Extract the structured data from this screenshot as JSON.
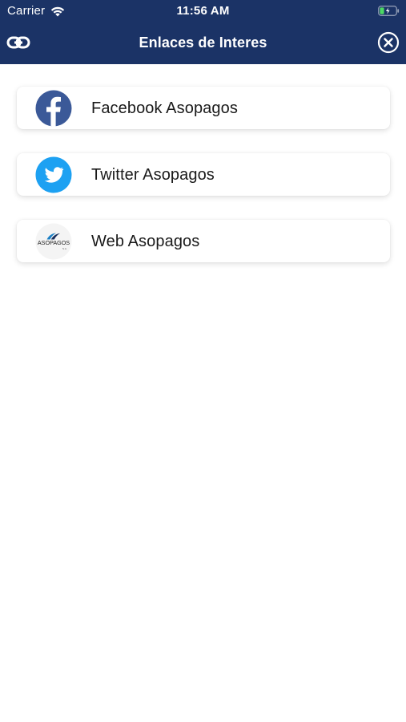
{
  "status_bar": {
    "carrier": "Carrier",
    "time": "11:56 AM"
  },
  "nav": {
    "title": "Enlaces de Interes",
    "left_icon": "link-icon",
    "right_icon": "close-circle-icon"
  },
  "links": [
    {
      "label": "Facebook Asopagos",
      "icon": "facebook-icon",
      "color": "#3b5998"
    },
    {
      "label": "Twitter Asopagos",
      "icon": "twitter-icon",
      "color": "#1da1f2"
    },
    {
      "label": "Web Asopagos",
      "icon": "asopagos-logo-icon",
      "logo_text": "ASOPAGOS"
    }
  ],
  "colors": {
    "header": "#1b3366",
    "background": "#ffffff",
    "battery": "#4cd964"
  }
}
